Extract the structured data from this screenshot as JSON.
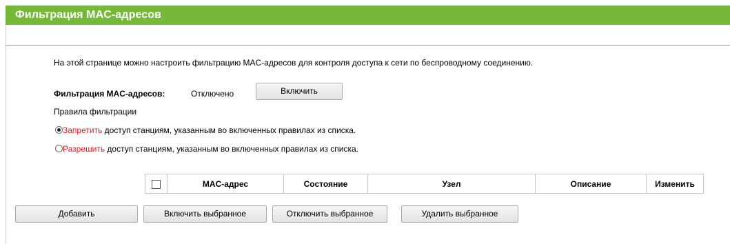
{
  "header": {
    "title": "Фильтрация MAC-адресов"
  },
  "description": "На этой странице можно настроить фильтрацию MAC-адресов для контроля доступа к сети по беспроводному соединению.",
  "filter_status": {
    "label": "Фильтрация MAC-адресов:",
    "value": "Отключено",
    "toggle_button": "Включить"
  },
  "rules": {
    "label": "Правила фильтрации",
    "deny": {
      "highlight": "Запретить",
      "text": " доступ станциям, указанным во включенных правилах из списка.",
      "selected": true
    },
    "allow": {
      "highlight": "Разрешить",
      "text": " доступ станциям, указанным во включенных правилах из списка.",
      "selected": false
    }
  },
  "table": {
    "columns": [
      "MAC-адрес",
      "Состояние",
      "Узел",
      "Описание",
      "Изменить"
    ]
  },
  "actions": {
    "add": "Добавить",
    "enable_selected": "Включить выбранное",
    "disable_selected": "Отключить выбранное",
    "delete_selected": "Удалить выбранное"
  },
  "colors": {
    "header_bg": "#75b83a",
    "highlight_red": "#e0191c"
  }
}
